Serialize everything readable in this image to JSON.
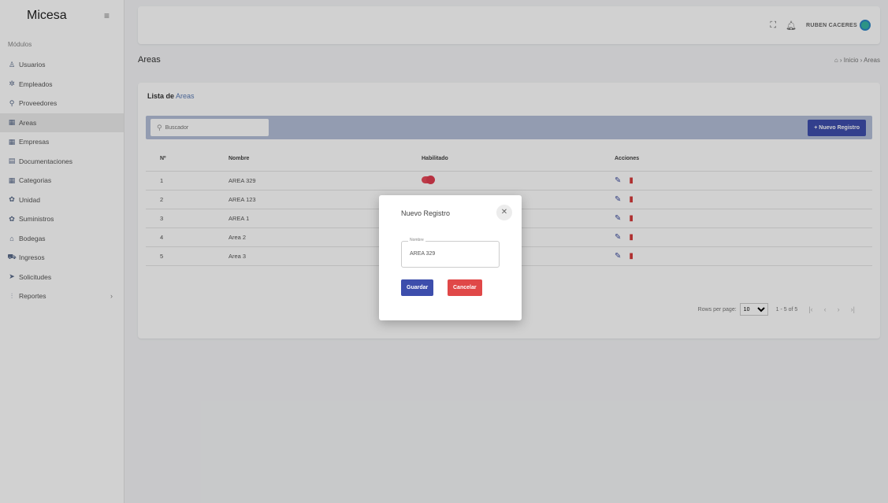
{
  "app": {
    "brand": "Micesa",
    "menu_icon": "menu-icon"
  },
  "sidebar": {
    "section_title": "Módulos",
    "items": [
      {
        "label": "Usuarios",
        "icon": "user-icon"
      },
      {
        "label": "Empleados",
        "icon": "people-icon"
      },
      {
        "label": "Proveedores",
        "icon": "supplier-icon"
      },
      {
        "label": "Areas",
        "icon": "grid-icon"
      },
      {
        "label": "Empresas",
        "icon": "building-icon"
      },
      {
        "label": "Documentaciones",
        "icon": "document-icon"
      },
      {
        "label": "Categorias",
        "icon": "category-icon"
      },
      {
        "label": "Unidad",
        "icon": "unit-icon"
      },
      {
        "label": "Suministros",
        "icon": "supply-icon"
      },
      {
        "label": "Bodegas",
        "icon": "warehouse-icon"
      },
      {
        "label": "Ingresos",
        "icon": "truck-icon"
      },
      {
        "label": "Solicitudes",
        "icon": "send-icon"
      },
      {
        "label": "Reportes",
        "icon": "chart-icon",
        "arrow": "›"
      }
    ]
  },
  "topbar": {
    "user_name": "RUBEN CACERES"
  },
  "page": {
    "title": "Areas",
    "breadcrumb": "⌂ › Inicio › Areas"
  },
  "card": {
    "title_prefix": "Lista de",
    "title_suffix": "Areas",
    "search_placeholder": "Buscador",
    "new_button": "+ Nuevo Registro"
  },
  "table": {
    "headers": {
      "n": "Nº",
      "nombre": "Nombre",
      "habilitado": "Habilitado",
      "acciones": "Acciones"
    },
    "rows": [
      {
        "n": "1",
        "nombre": "AREA 329",
        "toggle": true
      },
      {
        "n": "2",
        "nombre": "AREA 123",
        "toggle": false
      },
      {
        "n": "3",
        "nombre": "AREA 1",
        "toggle": false
      },
      {
        "n": "4",
        "nombre": "Area 2",
        "toggle": false
      },
      {
        "n": "5",
        "nombre": "Area 3",
        "toggle": false
      }
    ]
  },
  "pager": {
    "rows_per_page_label": "Rows per page:",
    "rows_per_page_value": "10",
    "range": "1 - 5 of 5"
  },
  "modal": {
    "title": "Nuevo Registro",
    "field_label": "Nombre",
    "field_value": "AREA 329",
    "save": "Guardar",
    "cancel": "Cancelar"
  },
  "colors": {
    "primary": "#3d4eac",
    "danger": "#e04848",
    "toolbar": "#b4bfd8"
  }
}
